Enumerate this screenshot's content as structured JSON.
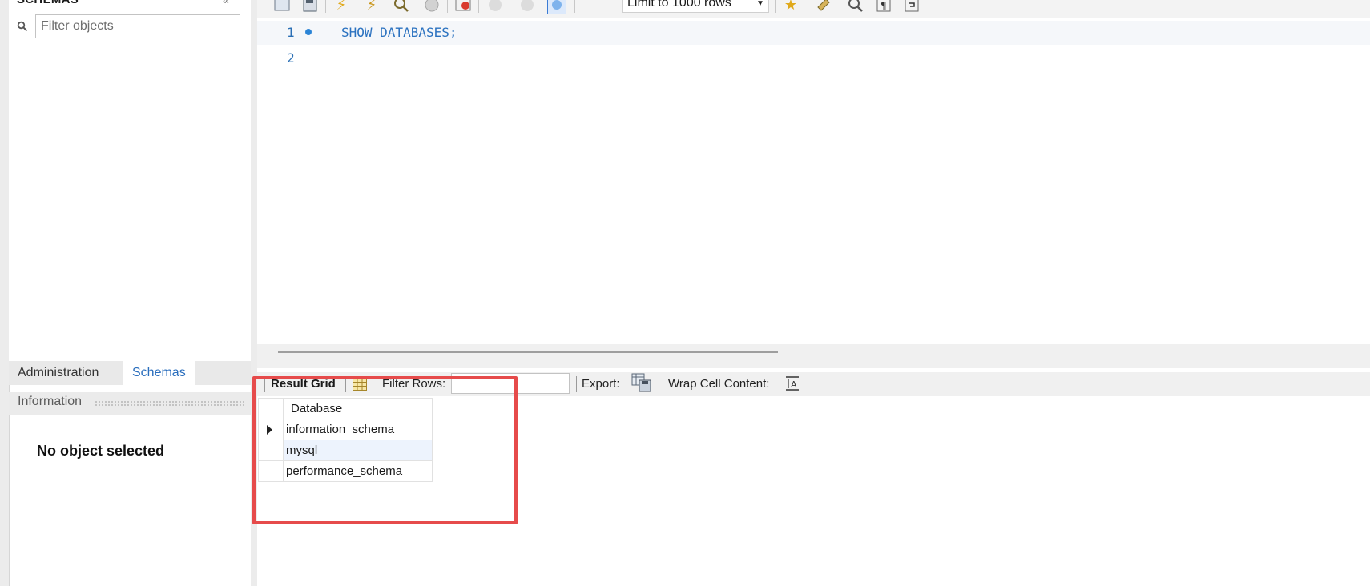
{
  "sidebar": {
    "title": "SCHEMAS",
    "filter_placeholder": "Filter objects",
    "tabs": [
      "Administration",
      "Schemas"
    ],
    "active_tab": "Schemas",
    "info_title": "Information",
    "info_message": "No object selected"
  },
  "toolbar": {
    "limit_label": "Limit to 1000 rows"
  },
  "editor": {
    "lines": [
      {
        "number": "1",
        "text": "SHOW DATABASES;"
      },
      {
        "number": "2",
        "text": ""
      }
    ]
  },
  "result_toolbar": {
    "result_grid_label": "Result Grid",
    "filter_rows_label": "Filter Rows:",
    "export_label": "Export:",
    "wrap_label": "Wrap Cell Content:"
  },
  "result_table": {
    "column": "Database",
    "rows": [
      "information_schema",
      "mysql",
      "performance_schema"
    ]
  },
  "colors": {
    "accent": "#2a6ebd",
    "highlight": "#e64b4b",
    "selected_row": "#edf3fd"
  }
}
